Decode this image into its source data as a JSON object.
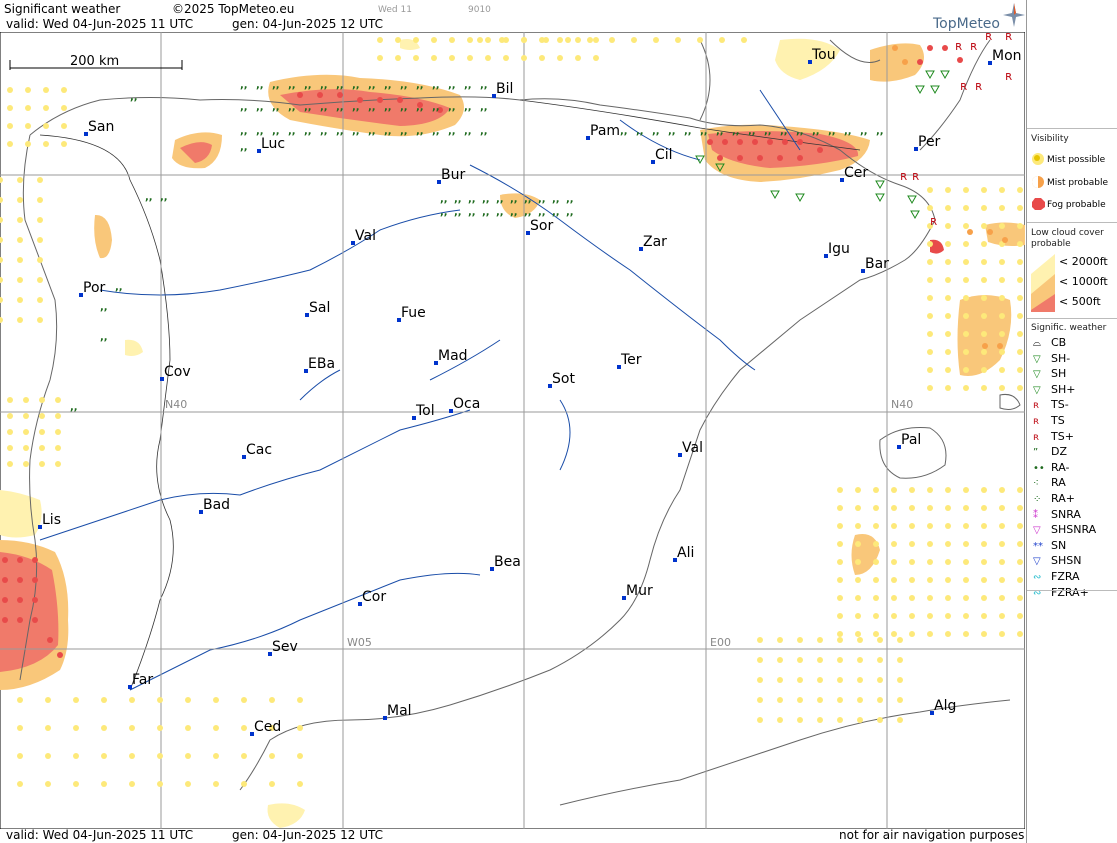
{
  "header": {
    "title": "Significant weather",
    "copyright": "©2025 TopMeteo.eu",
    "step": "Wed 11",
    "code": "9010",
    "valid": "valid:  Wed  04-Jun-2025  11 UTC",
    "gen": "gen: 04-Jun-2025 12 UTC",
    "logo": "TopMeteo"
  },
  "footer": {
    "valid": "valid:  Wed  04-Jun-2025  11 UTC",
    "gen": "gen: 04-Jun-2025 12 UTC",
    "disclaimer": "not for air navigation purposes"
  },
  "map": {
    "scale_label": "200 km",
    "grid_labels": [
      "N40",
      "N40",
      "W05",
      "E00"
    ],
    "cities": [
      "San",
      "Luc",
      "Bil",
      "Pam",
      "Cil",
      "Tou",
      "Mon",
      "Per",
      "Cer",
      "Bur",
      "Sor",
      "Zar",
      "Val",
      "Igu",
      "Bar",
      "Por",
      "Sal",
      "Fue",
      "Mad",
      "EBa",
      "Cov",
      "Ter",
      "Sot",
      "Tol",
      "Oca",
      "Pal",
      "Cac",
      "Val",
      "Bad",
      "Lis",
      "Ali",
      "Bea",
      "Mur",
      "Cor",
      "Sev",
      "Far",
      "Mal",
      "Alg",
      "Ced"
    ]
  },
  "legend": {
    "visibility_title": "Visibility",
    "visibility": [
      "Mist possible",
      "Mist probable",
      "Fog probable"
    ],
    "low_cloud_title": "Low cloud cover probable",
    "low_cloud": [
      "< 2000ft",
      "< 1000ft",
      "<   500ft"
    ],
    "sigwx_title": "Signific. weather",
    "sigwx": [
      "CB",
      "SH-",
      "SH",
      "SH+",
      "TS-",
      "TS",
      "TS+",
      "DZ",
      "RA-",
      "RA",
      "RA+",
      "SNRA",
      "SHSNRA",
      "SN",
      "SHSN",
      "FZRA",
      "FZRA+"
    ],
    "colors": {
      "mist_possible": "#fde97a",
      "mist_probable": "#f7a14a",
      "fog_probable": "#e84a4a",
      "cloud_2000": "#fff2b0",
      "cloud_1000": "#f9c77a",
      "cloud_500": "#f07a6a",
      "city": "#0033cc",
      "grid": "#9a9a9a",
      "coast": "#666666",
      "river": "#1a4da8"
    }
  }
}
